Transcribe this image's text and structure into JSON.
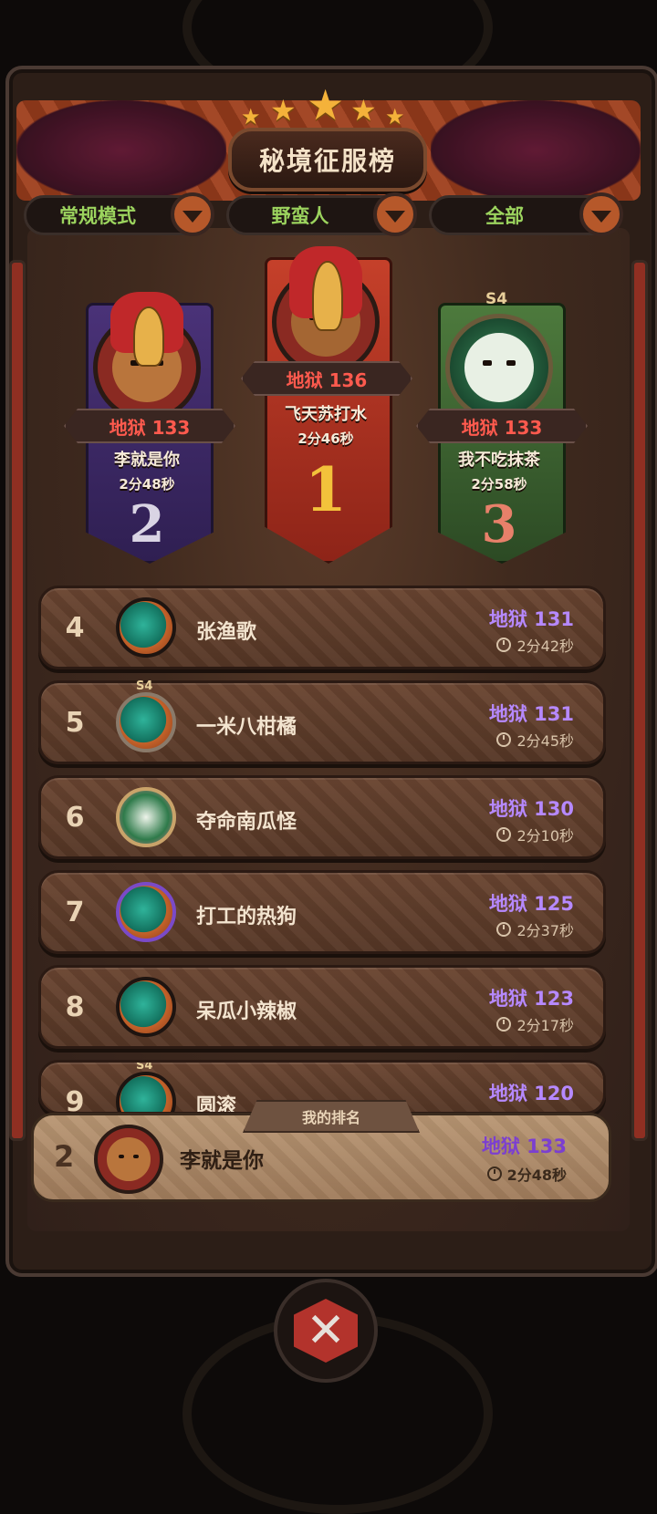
{
  "header": {
    "title": "秘境征服榜",
    "stars": 5
  },
  "filters": [
    {
      "label": "常规模式"
    },
    {
      "label": "野蛮人"
    },
    {
      "label": "全部"
    }
  ],
  "podium": [
    {
      "rank": "1",
      "score": "地狱 136",
      "name": "飞天苏打水",
      "time": "2分46秒"
    },
    {
      "rank": "2",
      "score": "地狱 133",
      "name": "李就是你",
      "time": "2分48秒"
    },
    {
      "rank": "3",
      "score": "地狱 133",
      "name": "我不吃抹茶",
      "time": "2分58秒",
      "badge": "S4"
    }
  ],
  "rows": [
    {
      "rank": "4",
      "name": "张渔歌",
      "score": "地狱 131",
      "time": "2分42秒"
    },
    {
      "rank": "5",
      "name": "一米八柑橘",
      "score": "地狱 131",
      "time": "2分45秒",
      "badge": "S4"
    },
    {
      "rank": "6",
      "name": "夺命南瓜怪",
      "score": "地狱 130",
      "time": "2分10秒"
    },
    {
      "rank": "7",
      "name": "打工的热狗",
      "score": "地狱 125",
      "time": "2分37秒"
    },
    {
      "rank": "8",
      "name": "呆瓜小辣椒",
      "score": "地狱 123",
      "time": "2分17秒"
    },
    {
      "rank": "9",
      "name": "圆滚",
      "score": "地狱 120",
      "badge": "S4"
    }
  ],
  "my_rank": {
    "tag": "我的排名",
    "rank": "2",
    "name": "李就是你",
    "score": "地狱 133",
    "time": "2分48秒"
  },
  "colors": {
    "score_red": "#ff5a4e",
    "score_purple": "#b689ff",
    "filter_green": "#9cd45e",
    "rank1": "#b8321f",
    "rank2": "#5a3f8e",
    "rank3": "#3d6a34"
  },
  "icons": {
    "close": "crossed-swords-close-icon",
    "dropdown": "chevron-down-icon",
    "clock": "clock-icon"
  }
}
